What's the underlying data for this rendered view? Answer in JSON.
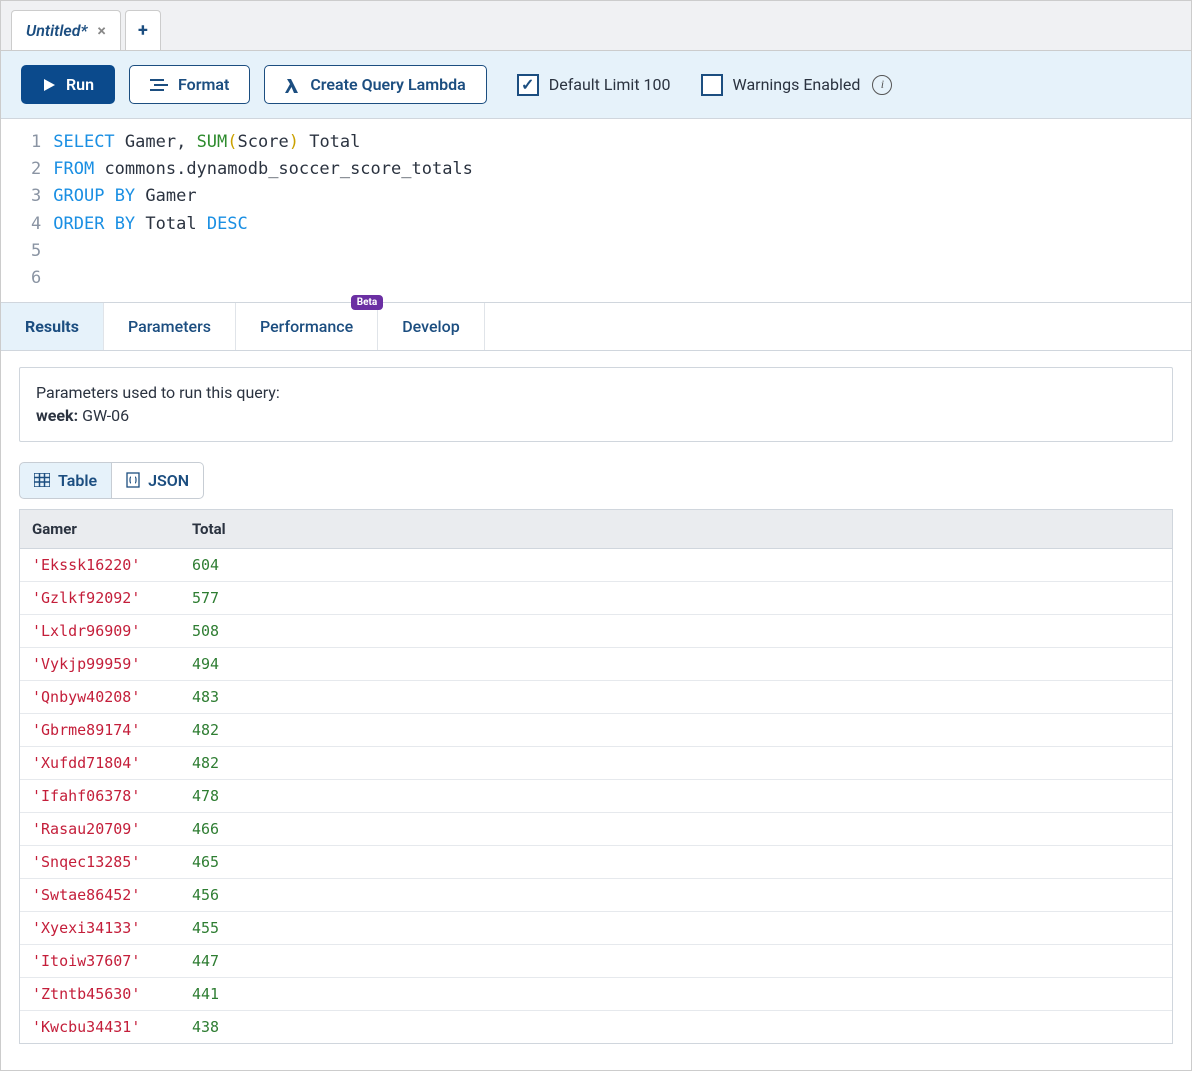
{
  "tabs": {
    "active_title": "Untitled*",
    "new_tab_label": "+"
  },
  "toolbar": {
    "run_label": "Run",
    "format_label": "Format",
    "create_lambda_label": "Create Query Lambda",
    "default_limit_label": "Default Limit 100",
    "warnings_enabled_label": "Warnings Enabled",
    "default_limit_checked": true,
    "warnings_enabled_checked": false
  },
  "editor": {
    "lines": [
      "SELECT Gamer, SUM(Score) Total",
      "FROM commons.dynamodb_soccer_score_totals",
      "GROUP BY Gamer",
      "ORDER BY Total DESC",
      "",
      ""
    ]
  },
  "result_tabs": {
    "results": "Results",
    "parameters": "Parameters",
    "performance": "Performance",
    "performance_badge": "Beta",
    "develop": "Develop"
  },
  "params_box": {
    "intro": "Parameters used to run this query:",
    "key": "week:",
    "value": "GW-06"
  },
  "view_toggle": {
    "table_label": "Table",
    "json_label": "JSON"
  },
  "table": {
    "columns": {
      "gamer": "Gamer",
      "total": "Total"
    },
    "rows": [
      {
        "gamer": "'Ekssk16220'",
        "total": "604"
      },
      {
        "gamer": "'Gzlkf92092'",
        "total": "577"
      },
      {
        "gamer": "'Lxldr96909'",
        "total": "508"
      },
      {
        "gamer": "'Vykjp99959'",
        "total": "494"
      },
      {
        "gamer": "'Qnbyw40208'",
        "total": "483"
      },
      {
        "gamer": "'Gbrme89174'",
        "total": "482"
      },
      {
        "gamer": "'Xufdd71804'",
        "total": "482"
      },
      {
        "gamer": "'Ifahf06378'",
        "total": "478"
      },
      {
        "gamer": "'Rasau20709'",
        "total": "466"
      },
      {
        "gamer": "'Snqec13285'",
        "total": "465"
      },
      {
        "gamer": "'Swtae86452'",
        "total": "456"
      },
      {
        "gamer": "'Xyexi34133'",
        "total": "455"
      },
      {
        "gamer": "'Itoiw37607'",
        "total": "447"
      },
      {
        "gamer": "'Ztntb45630'",
        "total": "441"
      },
      {
        "gamer": "'Kwcbu34431'",
        "total": "438"
      }
    ]
  }
}
